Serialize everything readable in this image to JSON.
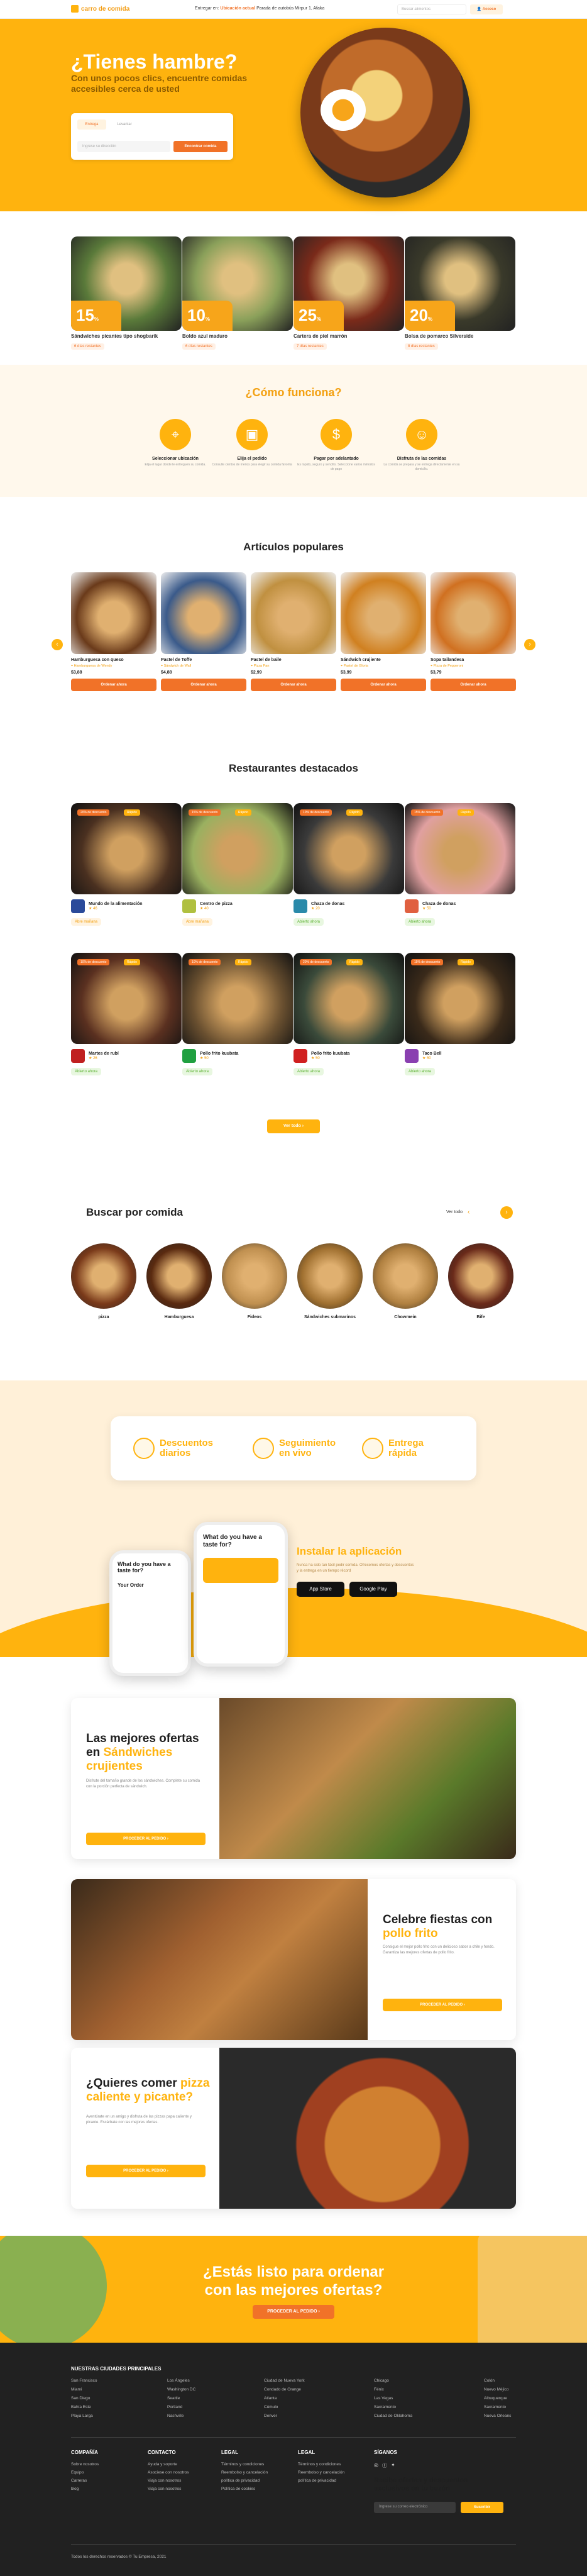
{
  "nav": {
    "brand": "carro de comida",
    "deliver_prefix": "Entregar en:",
    "deliver_sub": "Ubicación actual",
    "deliver_addr": "Parada de autobús Mirpur 1, Afaka",
    "search_placeholder": "Buscar alimentos",
    "login": "Acceso"
  },
  "hero": {
    "title": "¿Tienes hambre?",
    "subtitle": "Con unos pocos clics, encuentre comidas accesibles cerca de usted",
    "tab_delivery": "Entrega",
    "tab_pickup": "Levantar",
    "input_placeholder": "Ingrese su dirección",
    "button": "Encontrar comida"
  },
  "promos": [
    {
      "pct": "15",
      "unit": "%",
      "off": "Apagado",
      "name": "Sándwiches picantes tipo shogbarik",
      "days": "6 días restantes",
      "color": "#5a7a3a"
    },
    {
      "pct": "10",
      "unit": "%",
      "off": "Apagado",
      "name": "Boldo azul maduro",
      "days": "6 días restantes",
      "color": "#8aa05a"
    },
    {
      "pct": "25",
      "unit": "%",
      "off": "Apagado",
      "name": "Cartera de piel marrón",
      "days": "7 días restantes",
      "color": "#7a2a1a"
    },
    {
      "pct": "20",
      "unit": "%",
      "off": "Apagado",
      "name": "Bolsa de pomarco Silverside",
      "days": "8 días restantes",
      "color": "#3a3a2a"
    }
  ],
  "how": {
    "title": "¿Cómo funciona?",
    "steps": [
      {
        "title": "Seleccionar ubicación",
        "desc": "Elija el lugar donde le entreguen su comida."
      },
      {
        "title": "Elija el pedido",
        "desc": "Consulte cientos de menús para elegir su comida favorita"
      },
      {
        "title": "Pagar por adelantado",
        "desc": "Es rápido, seguro y sencillo. Seleccione varios métodos de pago"
      },
      {
        "title": "Disfruta de las comidas",
        "desc": "La comida se prepara y se entrega directamente en su domicilio."
      }
    ]
  },
  "popular": {
    "title": "Artículos populares",
    "items": [
      {
        "name": "Hamburguesa con queso",
        "place": "Hamburguesa de Wendy",
        "price": "$3,88",
        "color": "#6a3a1a",
        "btn": "Ordenar ahora"
      },
      {
        "name": "Pastel de Toffe",
        "place": "Sándwich de Wall",
        "price": "$4,88",
        "color": "#3a5a8a",
        "btn": "Ordenar ahora"
      },
      {
        "name": "Pastel de baile",
        "place": "Pizza Pan",
        "price": "$2,99",
        "color": "#c09040",
        "btn": "Ordenar ahora"
      },
      {
        "name": "Sándwich crujiente",
        "place": "Pastel de Gloria",
        "price": "$3,99",
        "color": "#d08020",
        "btn": "Ordenar ahora"
      },
      {
        "name": "Sopa tailandesa",
        "place": "Pizza de Pepperoni",
        "price": "$3,79",
        "color": "#d07020",
        "btn": "Ordenar ahora"
      }
    ]
  },
  "restaurants": {
    "title": "Restaurantes destacados",
    "items": [
      {
        "off": "20% de descuento",
        "fast": "Rápido",
        "name": "Mundo de la alimentación",
        "rating": "46",
        "status": "Abre mañana",
        "open": false,
        "color": "#4a3020",
        "logo": "#2a4a9a"
      },
      {
        "off": "15% de descuento",
        "fast": "Rápido",
        "name": "Centro de pizza",
        "rating": "40",
        "status": "Abre mañana",
        "open": false,
        "color": "#9ab060",
        "logo": "#b0c040"
      },
      {
        "off": "10% de descuento",
        "fast": "Rápido",
        "name": "Chaza de donas",
        "rating": "20",
        "status": "Abierto ahora",
        "open": true,
        "color": "#3a3a3a",
        "logo": "#2a8aaa"
      },
      {
        "off": "15% de descuento",
        "fast": "Rápido",
        "name": "Chaza de donas",
        "rating": "50",
        "status": "Abierto ahora",
        "open": true,
        "color": "#e0a0a0",
        "logo": "#e06040"
      },
      {
        "off": "10% de descuento",
        "fast": "Rápido",
        "name": "Martes de rubí",
        "rating": "26",
        "status": "Abierto ahora",
        "open": true,
        "color": "#5a3020",
        "logo": "#c02020"
      },
      {
        "off": "10% de descuento",
        "fast": "Rápido",
        "name": "Pollo frito kuubata",
        "rating": "50",
        "status": "Abierto ahora",
        "open": true,
        "color": "#6a5030",
        "logo": "#20a040"
      },
      {
        "off": "20% de descuento",
        "fast": "Rápido",
        "name": "Pollo frito kuubata",
        "rating": "50",
        "status": "Abierto ahora",
        "open": true,
        "color": "#3a4a3a",
        "logo": "#d02020"
      },
      {
        "off": "15% de descuento",
        "fast": "Rápido",
        "name": "Taco Bell",
        "rating": "50",
        "status": "Abierto ahora",
        "open": true,
        "color": "#3a2a1a",
        "logo": "#8a40b0"
      }
    ],
    "view_all": "Ver todo  ›"
  },
  "foods": {
    "title": "Buscar por comida",
    "view_all": "Ver todo",
    "items": [
      {
        "name": "pizza",
        "color": "#7a3a1a"
      },
      {
        "name": "Hamburguesa",
        "color": "#5a2a10"
      },
      {
        "name": "Fideos",
        "color": "#c09050"
      },
      {
        "name": "Sándwiches submarinos",
        "color": "#a07030"
      },
      {
        "name": "Chowmein",
        "color": "#b08040"
      },
      {
        "name": "Bife",
        "color": "#6a2a1a"
      }
    ]
  },
  "features": {
    "items": [
      "Descuentos diarios",
      "Seguimiento en vivo",
      "Entrega rápida"
    ],
    "app_title": "Instalar la aplicación",
    "app_desc": "Nunca ha sido tan fácil pedir comida. Ofrecemos ofertas y descuentos y la entrega en un tiempo récord",
    "appstore": "App Store",
    "googleplay": "Google Play",
    "phone_q": "What do you have a taste for?",
    "phone_order": "Your Order"
  },
  "offers": [
    {
      "t1": "Las mejores ofertas en ",
      "t2": "Sándwiches crujientes",
      "desc": "Disfrute del tamaño grande de los sándwiches. Complete su comida con la porción perfecta de sándwich.",
      "btn": "PROCEDER AL PEDIDO  ›"
    },
    {
      "t1": "Celebre fiestas con ",
      "t2": "pollo frito",
      "desc": "Consigue el mejor pollo frito con un delicioso sabor a chile y fondo. Garantiza las mejores ofertas de pollo frito.",
      "btn": "PROCEDER AL PEDIDO  ›"
    },
    {
      "t1": "¿Quieres comer ",
      "t2": "pizza caliente y picante?",
      "desc": "Aventúrate en un amigo y disfruta de las pizzas papa caliente y picante. Escárbate con las mejores ofertas.",
      "btn": "PROCEDER AL PEDIDO  ›"
    }
  ],
  "cta": {
    "title": "¿Estás listo para ordenar con las mejores ofertas?",
    "button": "PROCEDER AL PEDIDO  ›"
  },
  "footer": {
    "cities_title": "NUESTRAS CIUDADES PRINCIPALES",
    "cities": [
      [
        "San Francisco",
        "Miami",
        "San Diego",
        "Bahía Este",
        "Playa Larga"
      ],
      [
        "Los Ángeles",
        "Washington DC",
        "Seattle",
        "Portland",
        "Nashville"
      ],
      [
        "Ciudad de Nueva York",
        "Condado de Orange",
        "Atlanta",
        "Cúmulo",
        "Denver"
      ],
      [
        "Chicago",
        "Fénix",
        "Las Vegas",
        "Sacramento",
        "Ciudad de Oklahoma"
      ],
      [
        "Colón",
        "Nuevo Méjico",
        "Albuquerque",
        "Sacramento",
        "Nueva Orleans"
      ]
    ],
    "company": "COMPAÑÍA",
    "company_links": [
      "Sobre nosotros",
      "Equipo",
      "Carreras",
      "blog"
    ],
    "contact": "CONTACTO",
    "contact_links": [
      "Ayuda y soporte",
      "Asociese con nosotros",
      "Viaja con nosotros",
      "Viaja con nosotros"
    ],
    "legal": "LEGAL",
    "legal_links": [
      "Términos y condiciones",
      "Reembolso y cancelación",
      "política de privacidad",
      "Política de cookies"
    ],
    "legal2": "LEGAL",
    "legal2_links": [
      "Términos y condiciones",
      "Reembolso y cancelación",
      "política de privacidad"
    ],
    "follow": "SÍGANOS",
    "newsletter": "Recibe ofertas y descuentos exclusivos en tu buzón",
    "email_placeholder": "Ingrese su correo electrónico",
    "subscribe": "Suscribir",
    "copyright": "Todos los derechos reservados © Tu Empresa, 2021"
  }
}
